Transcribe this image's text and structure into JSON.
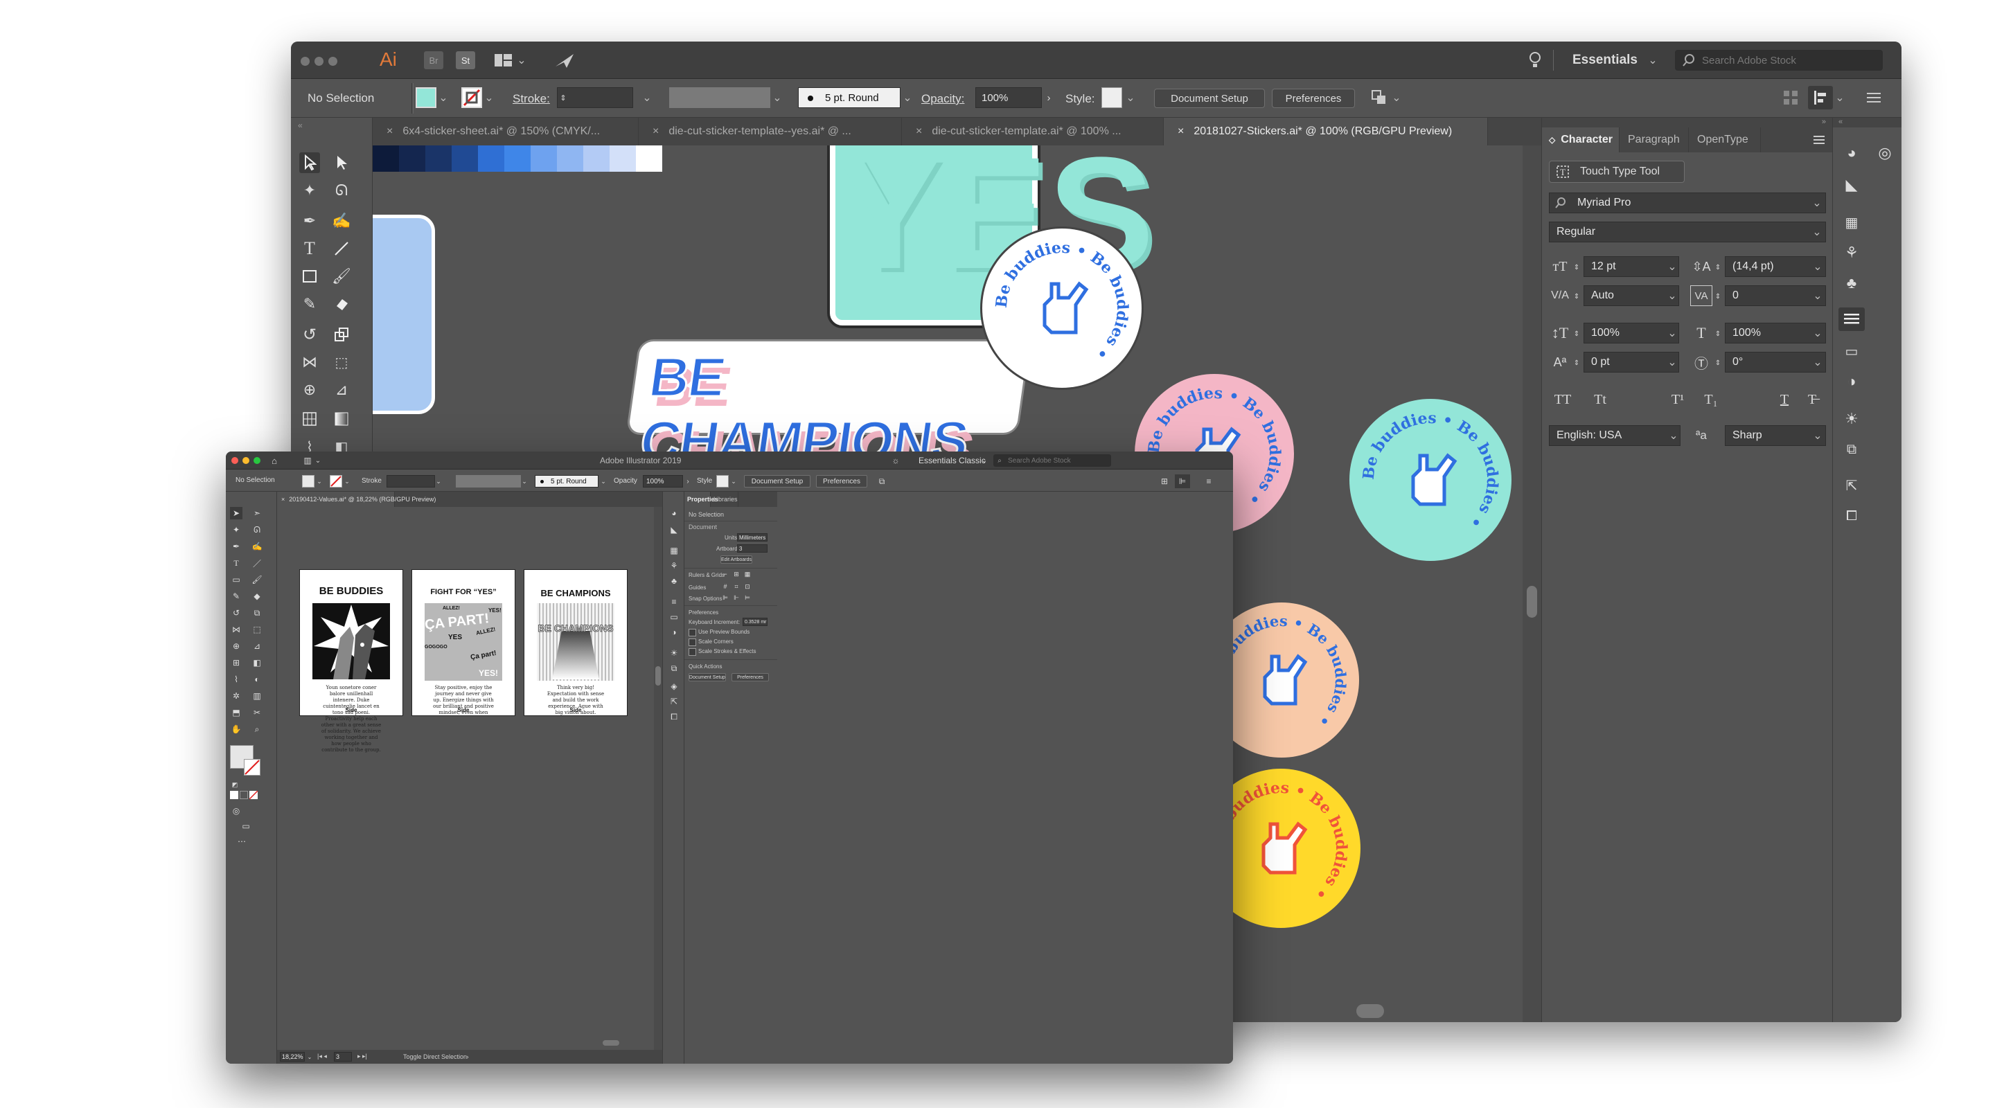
{
  "back_window": {
    "app_logo": "Ai",
    "bridge_label": "Br",
    "stock_label": "St",
    "workspace": "Essentials",
    "search_placeholder": "Search Adobe Stock",
    "control": {
      "selection": "No Selection",
      "stroke_label": "Stroke:",
      "brush": "5 pt. Round",
      "opacity_label": "Opacity:",
      "opacity_value": "100%",
      "style_label": "Style:",
      "document_setup": "Document Setup",
      "preferences": "Preferences"
    },
    "tabs": [
      {
        "label": "6x4-sticker-sheet.ai* @ 150% (CMYK/..."
      },
      {
        "label": "die-cut-sticker-template--yes.ai* @ ..."
      },
      {
        "label": "die-cut-sticker-template.ai* @ 100% ..."
      },
      {
        "label": "20181027-Stickers.ai* @ 100% (RGB/GPU Preview)"
      }
    ],
    "swatches": [
      "#0d1b3a",
      "#14264f",
      "#1a3468",
      "#204a94",
      "#2f6fd4",
      "#3f86e8",
      "#6ea2ef",
      "#8fb6f2",
      "#b3cbf5",
      "#d3e0f9",
      "#ffffff"
    ],
    "canvas": {
      "yes_text": "YES",
      "champions_text": "BE CHAMPIONS",
      "buddies_text": "Be buddies",
      "sticker_colors": {
        "mint": "#93e6d8",
        "blue": "#2f6fe0",
        "pink": "#f4b6c6",
        "peach": "#f8c9a8",
        "yellow": "#ffd92a",
        "lightblue": "#a9c9f2"
      }
    },
    "character_panel": {
      "tabs": [
        "Character",
        "Paragraph",
        "OpenType"
      ],
      "touch_type": "Touch Type Tool",
      "font_family": "Myriad Pro",
      "font_style": "Regular",
      "size": "12 pt",
      "leading": "(14,4 pt)",
      "kerning": "Auto",
      "tracking": "0",
      "vscale": "100%",
      "hscale": "100%",
      "baseline": "0 pt",
      "rotation": "0°",
      "type_buttons": [
        "TT",
        "Tt",
        "T¹",
        "T₁",
        "T",
        "T̶"
      ],
      "language": "English: USA",
      "aa_label": "ªa",
      "antialias": "Sharp"
    }
  },
  "front_window": {
    "title": "Adobe Illustrator 2019",
    "workspace": "Essentials Classic",
    "search_placeholder": "Search Adobe Stock",
    "control": {
      "selection": "No Selection",
      "stroke_label": "Stroke",
      "brush": "5 pt. Round",
      "opacity_label": "Opacity",
      "opacity_value": "100%",
      "style_label": "Style",
      "document_setup": "Document Setup",
      "preferences": "Preferences"
    },
    "doc_tab": "20190412-Values.ai* @ 18,22% (RGB/GPU Preview)",
    "posters": [
      {
        "title": "BE BUDDIES",
        "side": "Side",
        "body": "Youn sonetore coner balore unillenhall intenere. Duke cuintenteglie lancet en tono sad poeni. Proactivity help each other with a great sense of solidarity. We achieve working together and how people who contribute to the group."
      },
      {
        "title": "FIGHT FOR “YES”",
        "side": "Side",
        "body": "Stay positive, enjoy the journey and never give up. Energize things with our brilliant and positive mindset, even when things don’t go as planned. We show our energy from a real and fully place.",
        "words": [
          "ÇA PART!",
          "ALLEZ!",
          "YES!",
          "YES",
          "GOGOGO",
          "Ça part!",
          "ALLEZ!",
          "YES!"
        ]
      },
      {
        "title": "BE CHAMPIONS",
        "side": "Side",
        "body": "Think very big! Expectation with sense and build the work experience. Ague with big vision about. Compete fiercely and win together with humility. We're inspired by making a difference in everything we do to be the market definer of the future of work.",
        "overlay": "BE CHAMPIONS"
      }
    ],
    "properties": {
      "tabs": [
        "Properties",
        "Libraries"
      ],
      "selection": "No Selection",
      "document_label": "Document",
      "units_label": "Units:",
      "units": "Millimeters",
      "artboard_label": "Artboard:",
      "artboard": "3",
      "edit_artboards": "Edit Artboards",
      "rulers_grids": "Rulers & Grids",
      "guides": "Guides",
      "snap_options": "Snap Options",
      "preferences_label": "Preferences",
      "keyboard_increment_label": "Keyboard Increment:",
      "keyboard_increment": "0.3528 mr",
      "checkboxes": [
        "Use Preview Bounds",
        "Scale Corners",
        "Scale Strokes & Effects"
      ],
      "quick_actions": "Quick Actions",
      "document_setup": "Document Setup",
      "preferences": "Preferences"
    },
    "status": {
      "zoom": "18,22%",
      "artboard": "3",
      "tool": "Toggle Direct Selection"
    }
  }
}
